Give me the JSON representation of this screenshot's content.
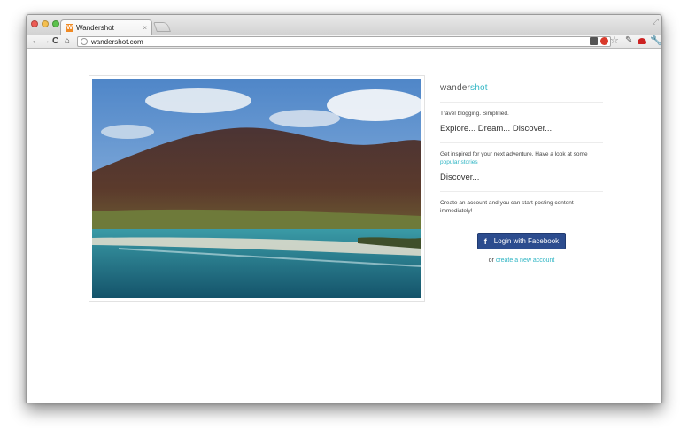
{
  "browser": {
    "tab": {
      "title": "Wandershot",
      "favicon": "W",
      "close_glyph": "×"
    },
    "url": "wandershot.com"
  },
  "colors": {
    "accent": "#2fb5c4",
    "facebook": "#2c4c8e"
  },
  "brand": {
    "name_plain": "wander",
    "name_accent": "shot"
  },
  "sections": {
    "tagline": "Travel blogging. Simplified.",
    "headline": "Explore... Dream... Discover...",
    "inspire_text": "Get inspired for your next adventure. Have a look at some",
    "inspire_link": "popular stories",
    "discover": "Discover...",
    "account_text": "Create an account and you can start posting content immediately!"
  },
  "login": {
    "facebook_icon": "f",
    "facebook_label": "Login with Facebook",
    "or_text": "or",
    "create_link": "create a new account"
  },
  "icons": [
    "back-icon",
    "forward-icon",
    "reload-icon",
    "home-icon",
    "globe-icon",
    "star-icon",
    "wrench-icon"
  ]
}
